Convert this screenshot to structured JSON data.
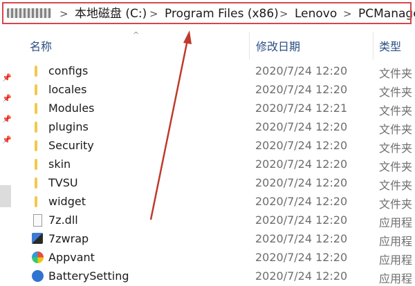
{
  "address_bar": {
    "crumbs": [
      "本地磁盘 (C:)",
      "Program Files (x86)",
      "Lenovo",
      "PCManage"
    ],
    "separator": ">"
  },
  "columns": {
    "name": "名称",
    "modified": "修改日期",
    "type": "类型"
  },
  "files": [
    {
      "name": "configs",
      "date": "2020/7/24 12:20",
      "type": "文件夹",
      "icon": "folder-icon"
    },
    {
      "name": "locales",
      "date": "2020/7/24 12:20",
      "type": "文件夹",
      "icon": "folder-icon"
    },
    {
      "name": "Modules",
      "date": "2020/7/24 12:21",
      "type": "文件夹",
      "icon": "folder-icon"
    },
    {
      "name": "plugins",
      "date": "2020/7/24 12:20",
      "type": "文件夹",
      "icon": "folder-icon"
    },
    {
      "name": "Security",
      "date": "2020/7/24 12:20",
      "type": "文件夹",
      "icon": "folder-icon"
    },
    {
      "name": "skin",
      "date": "2020/7/24 12:20",
      "type": "文件夹",
      "icon": "folder-icon"
    },
    {
      "name": "TVSU",
      "date": "2020/7/24 12:20",
      "type": "文件夹",
      "icon": "folder-icon"
    },
    {
      "name": "widget",
      "date": "2020/7/24 12:20",
      "type": "文件夹",
      "icon": "folder-icon"
    },
    {
      "name": "7z.dll",
      "date": "2020/7/24 12:20",
      "type": "应用程",
      "icon": "dll-file-icon"
    },
    {
      "name": "7zwrap",
      "date": "2020/7/24 12:20",
      "type": "应用程",
      "icon": "app-icon"
    },
    {
      "name": "Appvant",
      "date": "2020/7/24 12:20",
      "type": "应用程",
      "icon": "appvant-icon"
    },
    {
      "name": "BatterySetting",
      "date": "2020/7/24 12:20",
      "type": "应用程",
      "icon": "battery-icon"
    }
  ],
  "colors": {
    "highlight_box": "#d6454b",
    "arrow": "#c0392b",
    "folder": "#f2c94c",
    "header_text": "#2b4e84"
  }
}
